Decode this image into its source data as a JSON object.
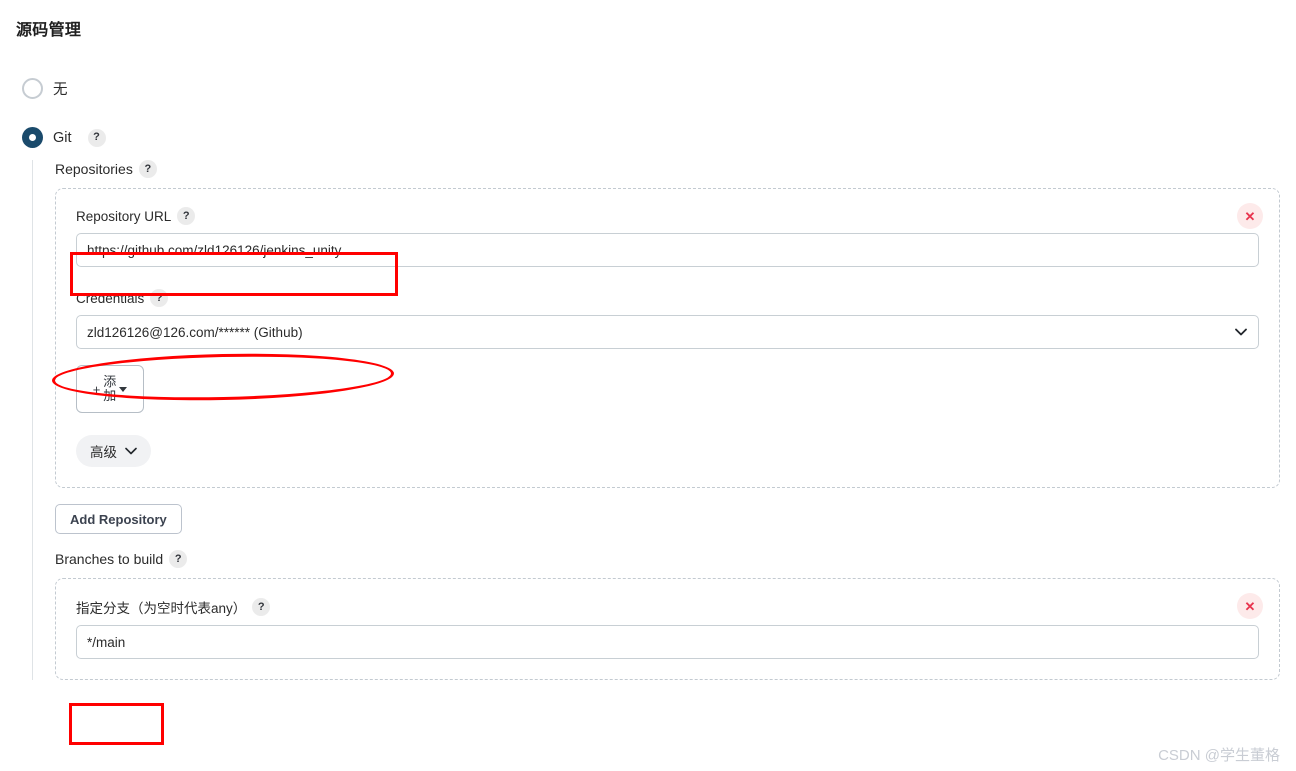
{
  "page": {
    "title": "源码管理"
  },
  "scm_options": [
    {
      "label": "无",
      "selected": false,
      "has_help": false
    },
    {
      "label": "Git",
      "selected": true,
      "has_help": true
    }
  ],
  "git": {
    "repositories_label": "Repositories",
    "repository": {
      "url_label": "Repository URL",
      "url_value": "https://github.com/zld126126/jenkins_unity",
      "credentials_label": "Credentials",
      "credentials_value": "zld126126@126.com/****** (Github)",
      "add_button": {
        "plus": "+",
        "line1": "添",
        "line2": "加"
      },
      "advanced_button": "高级",
      "delete_button": "✕"
    },
    "add_repository_button": "Add Repository",
    "branches": {
      "label": "Branches to build",
      "spec_label": "指定分支（为空时代表any）",
      "spec_value": "*/main",
      "delete_button": "✕"
    }
  },
  "help_glyph": "?",
  "watermark": "CSDN @学生董格",
  "colors": {
    "accent": "#1a4a6b",
    "annotation": "#ff0000",
    "delete": "#e8344e",
    "dashed_border": "#c3cad1"
  }
}
